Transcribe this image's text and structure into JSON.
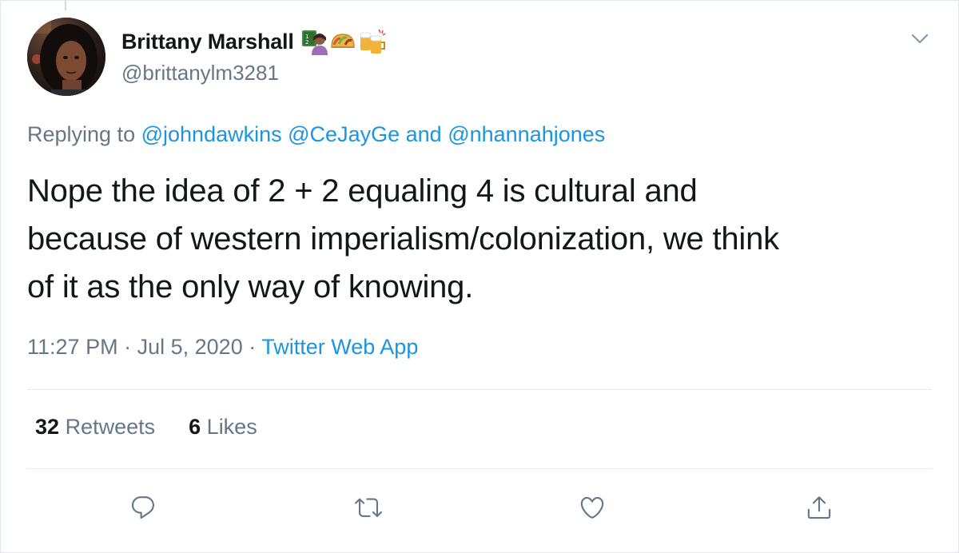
{
  "author": {
    "display_name": "Brittany Marshall",
    "handle": "@brittanylm3281",
    "name_emojis": [
      "woman-teacher-emoji",
      "taco-emoji",
      "beer-mugs-emoji"
    ]
  },
  "reply": {
    "prefix": "Replying to",
    "mention_1": "@johndawkins",
    "mention_2": "@CeJayGe",
    "joiner": "and",
    "mention_3": "@nhannahjones"
  },
  "tweet": {
    "line_1": "Nope the idea of 2 + 2 equaling 4 is cultural and",
    "line_2": "because of western imperialism/colonization, we think",
    "line_3": "of it as the only way of knowing."
  },
  "meta": {
    "time": "11:27 PM",
    "separator": "·",
    "date": "Jul 5, 2020",
    "source": "Twitter Web App"
  },
  "stats": {
    "retweets_count": "32",
    "retweets_label": "Retweets",
    "likes_count": "6",
    "likes_label": "Likes"
  },
  "actions": {
    "icons": [
      "reply-icon",
      "retweet-icon",
      "like-icon",
      "share-icon"
    ]
  },
  "colors": {
    "text": "#14171a",
    "secondary": "#657786",
    "link": "#1b95e0",
    "divider": "#e6ecf0"
  }
}
